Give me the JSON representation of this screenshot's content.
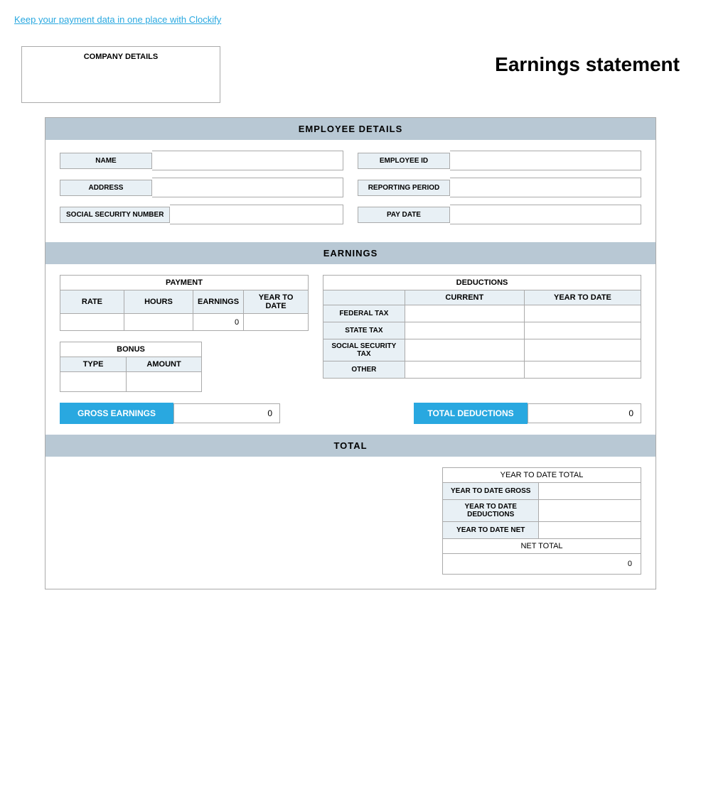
{
  "topLink": {
    "text": "Keep your payment data in one place with Clockify"
  },
  "header": {
    "companyLabel": "COMPANY DETAILS",
    "docTitle": "Earnings statement"
  },
  "employeeDetails": {
    "sectionTitle": "EMPLOYEE DETAILS",
    "fields": [
      {
        "label": "NAME",
        "value": ""
      },
      {
        "label": "EMPLOYEE ID",
        "value": ""
      },
      {
        "label": "ADDRESS",
        "value": ""
      },
      {
        "label": "REPORTING PERIOD",
        "value": ""
      },
      {
        "label": "SOCIAL SECURITY NUMBER",
        "value": ""
      },
      {
        "label": "PAY DATE",
        "value": ""
      }
    ]
  },
  "earnings": {
    "sectionTitle": "EARNINGS",
    "payment": {
      "tableTitle": "PAYMENT",
      "columns": [
        "RATE",
        "HOURS",
        "EARNINGS",
        "YEAR TO DATE"
      ],
      "rows": [
        {
          "rate": "",
          "hours": "",
          "earnings": "0",
          "yearToDate": ""
        }
      ]
    },
    "deductions": {
      "tableTitle": "DEDUCTIONS",
      "columns": [
        "CURRENT",
        "YEAR TO DATE"
      ],
      "rows": [
        {
          "label": "FEDERAL TAX",
          "current": "",
          "yearToDate": ""
        },
        {
          "label": "STATE TAX",
          "current": "",
          "yearToDate": ""
        },
        {
          "label": "SOCIAL SECURITY TAX",
          "current": "",
          "yearToDate": ""
        },
        {
          "label": "OTHER",
          "current": "",
          "yearToDate": ""
        }
      ]
    },
    "bonus": {
      "tableTitle": "BONUS",
      "columns": [
        "TYPE",
        "AMOUNT"
      ],
      "rows": [
        {
          "type": "",
          "amount": ""
        }
      ]
    },
    "grossEarnings": {
      "label": "GROSS EARNINGS",
      "value": "0"
    },
    "totalDeductions": {
      "label": "TOTAL DEDUCTIONS",
      "value": "0"
    }
  },
  "total": {
    "sectionTitle": "TOTAL",
    "ytdTitle": "YEAR TO DATE TOTAL",
    "ytdRows": [
      {
        "label": "YEAR TO DATE GROSS",
        "value": ""
      },
      {
        "label": "YEAR TO DATE DEDUCTIONS",
        "value": ""
      },
      {
        "label": "YEAR TO DATE NET",
        "value": ""
      }
    ],
    "netTotalLabel": "NET TOTAL",
    "netTotalValue": "0"
  }
}
